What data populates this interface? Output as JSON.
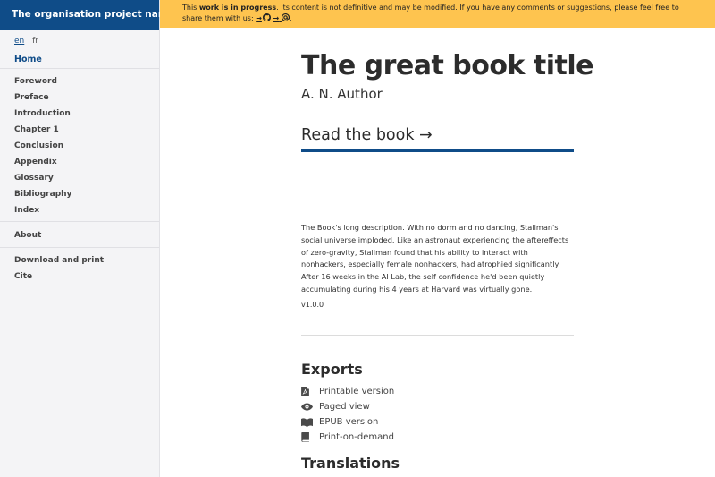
{
  "sidebar": {
    "title": "The organisation project name",
    "languages": [
      "en",
      "fr"
    ],
    "home": "Home",
    "chapters": [
      "Foreword",
      "Preface",
      "Introduction",
      "Chapter 1",
      "Conclusion",
      "Appendix",
      "Glossary",
      "Bibliography",
      "Index"
    ],
    "about": "About",
    "extras": [
      "Download and print",
      "Cite"
    ]
  },
  "banner": {
    "prefix": "This ",
    "bold": "work is in progress",
    "message": ". Its content is not definitive and may be modified. If you have any comments or suggestions, please feel free to share them with us: ",
    "link1": "→",
    "link2": "→",
    "suffix": "."
  },
  "book": {
    "title": "The great book title",
    "author": "A. N. Author",
    "read_link": "Read the book →",
    "description": "The Book's long description. With no dorm and no dancing, Stallman's social universe imploded. Like an astronaut experiencing the aftereffects of zero-gravity, Stallman found that his ability to interact with nonhackers, especially female nonhackers, had atrophied significantly. After 16 weeks in the AI Lab, the self confidence he'd been quietly accumulating during his 4 years at Harvard was virtually gone.",
    "version": "v1.0.0"
  },
  "exports": {
    "heading": "Exports",
    "items": [
      {
        "label": "Printable version",
        "icon": "pdf-file-icon"
      },
      {
        "label": "Paged view",
        "icon": "eye-icon"
      },
      {
        "label": "EPUB version",
        "icon": "book-open-icon"
      },
      {
        "label": "Print-on-demand",
        "icon": "book-icon"
      }
    ]
  },
  "translations": {
    "heading": "Translations"
  },
  "colors": {
    "primary": "#0f4c88",
    "banner": "#fec44f",
    "sidebar_bg": "#f4f4f6"
  }
}
